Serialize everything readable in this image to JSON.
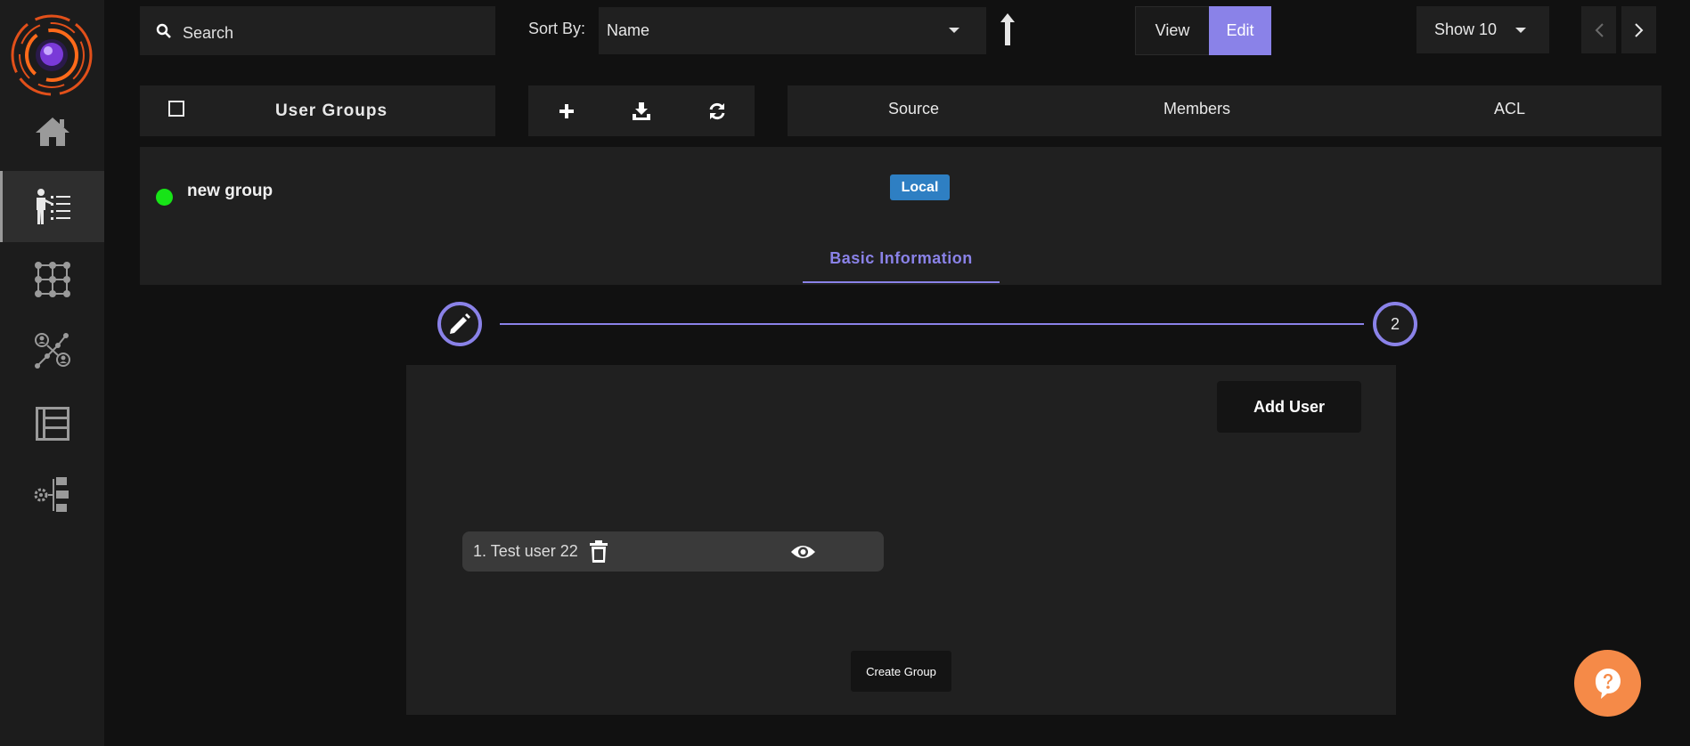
{
  "colors": {
    "accent": "#8a82e8",
    "status_online": "#17e417",
    "badge_local": "#2e7fc3",
    "help": "#f58a48"
  },
  "sidebar": {
    "items": [
      {
        "icon": "home-icon"
      },
      {
        "icon": "user-groups-icon",
        "active": true
      },
      {
        "icon": "grid-network-icon"
      },
      {
        "icon": "user-network-icon"
      },
      {
        "icon": "table-list-icon"
      },
      {
        "icon": "settings-tree-icon"
      }
    ]
  },
  "toolbar": {
    "search_placeholder": "Search",
    "sort_label": "Sort By:",
    "sort_value": "Name",
    "view_label": "View",
    "edit_label": "Edit",
    "show_value": "Show 10"
  },
  "list_header": {
    "title": "User Groups",
    "columns": [
      "Source",
      "Members",
      "ACL"
    ]
  },
  "group": {
    "name": "new group",
    "source": "Local"
  },
  "tabs": {
    "basic": "Basic Information"
  },
  "stepper": {
    "step2": "2"
  },
  "members": {
    "add_user": "Add User",
    "users": [
      "1. Test user 22"
    ],
    "create_group": "Create Group"
  }
}
